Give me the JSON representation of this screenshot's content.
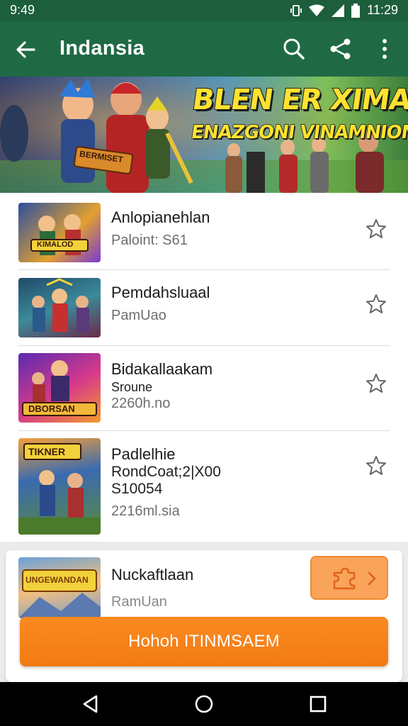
{
  "status_bar": {
    "time_left": "9:49",
    "time_right": "11:29"
  },
  "app_bar": {
    "title": "Indansia"
  },
  "banner": {
    "line1": "BLEN ER XIMA",
    "line2": "ENAZGONI VINAMNION",
    "sign_text": "BERMISET"
  },
  "list": [
    {
      "name": "Anlopianehlan",
      "lines": [
        "Paloint: S61"
      ]
    },
    {
      "name": "Pemdahsluaal",
      "lines": [
        "PamUao"
      ]
    },
    {
      "name": "Bidakallaakam",
      "lines": [
        "Sroune",
        "2260h.no"
      ]
    },
    {
      "name": "Padlelhie",
      "lines": [
        "RondCoat;2|X00",
        "S10054",
        "2216ml.sia"
      ]
    }
  ],
  "list_thumb_labels": [
    "KIMALOD",
    "",
    "DBORSAN",
    "TIKNER"
  ],
  "card": {
    "name": "Nuckaftlaan",
    "sub": "RamUan",
    "thumb_label": "UNGEWANDAN",
    "button_label": "Hohoh ITINMSAEM"
  },
  "colors": {
    "status_bar": "#1d5e3c",
    "app_bar": "#1f6a45",
    "accent": "#f27a12"
  },
  "icons": {
    "app_bar": [
      "back-arrow-icon",
      "search-icon",
      "share-icon",
      "more-vert-icon"
    ],
    "list_action": "star-outline-icon",
    "card_action": "puzzle-icon",
    "nav": [
      "nav-back-icon",
      "nav-home-icon",
      "nav-recents-icon"
    ]
  }
}
